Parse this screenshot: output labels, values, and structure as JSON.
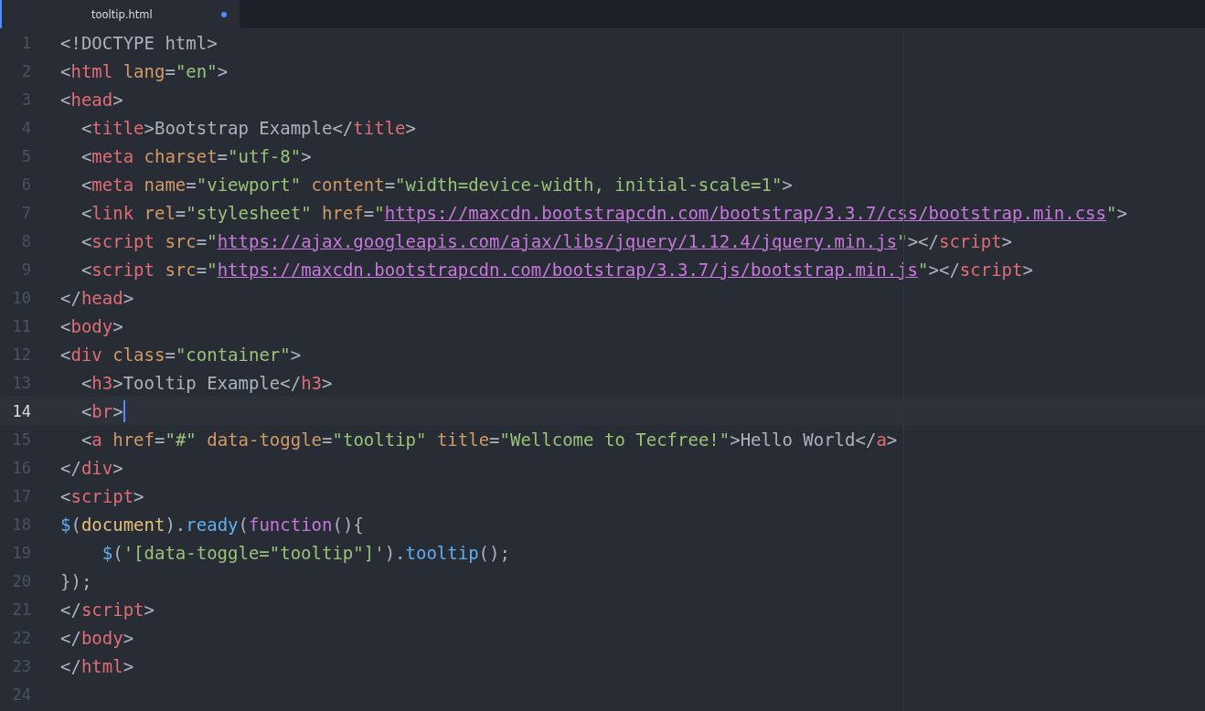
{
  "tab": {
    "label": "tooltip.html",
    "modified": true,
    "selected": true
  },
  "lines": [
    {
      "number": "1",
      "current": false,
      "tokens": [
        {
          "kind": "p",
          "text": "<!DOCTYPE html>"
        }
      ]
    },
    {
      "number": "2",
      "current": false,
      "tokens": [
        {
          "kind": "p",
          "text": "<"
        },
        {
          "kind": "g",
          "text": "html"
        },
        {
          "kind": "a",
          "text": " lang"
        },
        {
          "kind": "p",
          "text": "="
        },
        {
          "kind": "s",
          "text": "\"en\""
        },
        {
          "kind": "p",
          "text": ">"
        }
      ]
    },
    {
      "number": "3",
      "current": false,
      "tokens": [
        {
          "kind": "p",
          "text": "<"
        },
        {
          "kind": "g",
          "text": "head"
        },
        {
          "kind": "p",
          "text": ">"
        }
      ]
    },
    {
      "number": "4",
      "current": false,
      "tokens": [
        {
          "kind": "p",
          "text": "  <"
        },
        {
          "kind": "g",
          "text": "title"
        },
        {
          "kind": "p",
          "text": ">Bootstrap Example</"
        },
        {
          "kind": "g",
          "text": "title"
        },
        {
          "kind": "p",
          "text": ">"
        }
      ]
    },
    {
      "number": "5",
      "current": false,
      "tokens": [
        {
          "kind": "p",
          "text": "  <"
        },
        {
          "kind": "g",
          "text": "meta"
        },
        {
          "kind": "a",
          "text": " charset"
        },
        {
          "kind": "p",
          "text": "="
        },
        {
          "kind": "s",
          "text": "\"utf-8\""
        },
        {
          "kind": "p",
          "text": ">"
        }
      ]
    },
    {
      "number": "6",
      "current": false,
      "tokens": [
        {
          "kind": "p",
          "text": "  <"
        },
        {
          "kind": "g",
          "text": "meta"
        },
        {
          "kind": "a",
          "text": " name"
        },
        {
          "kind": "p",
          "text": "="
        },
        {
          "kind": "s",
          "text": "\"viewport\""
        },
        {
          "kind": "a",
          "text": " content"
        },
        {
          "kind": "p",
          "text": "="
        },
        {
          "kind": "s",
          "text": "\"width=device-width, initial-scale=1\""
        },
        {
          "kind": "p",
          "text": ">"
        }
      ]
    },
    {
      "number": "7",
      "current": false,
      "tokens": [
        {
          "kind": "p",
          "text": "  <"
        },
        {
          "kind": "g",
          "text": "link"
        },
        {
          "kind": "a",
          "text": " rel"
        },
        {
          "kind": "p",
          "text": "="
        },
        {
          "kind": "s",
          "text": "\"stylesheet\""
        },
        {
          "kind": "a",
          "text": " href"
        },
        {
          "kind": "p",
          "text": "="
        },
        {
          "kind": "s",
          "text": "\""
        },
        {
          "kind": "u",
          "text": "https://maxcdn.bootstrapcdn.com/bootstrap/3.3.7/css/bootstrap.min.css"
        },
        {
          "kind": "s",
          "text": "\""
        },
        {
          "kind": "p",
          "text": ">"
        }
      ]
    },
    {
      "number": "8",
      "current": false,
      "tokens": [
        {
          "kind": "p",
          "text": "  <"
        },
        {
          "kind": "g",
          "text": "script"
        },
        {
          "kind": "a",
          "text": " src"
        },
        {
          "kind": "p",
          "text": "="
        },
        {
          "kind": "s",
          "text": "\""
        },
        {
          "kind": "u",
          "text": "https://ajax.googleapis.com/ajax/libs/jquery/1.12.4/jquery.min.js"
        },
        {
          "kind": "s",
          "text": "\""
        },
        {
          "kind": "p",
          "text": "></"
        },
        {
          "kind": "g",
          "text": "script"
        },
        {
          "kind": "p",
          "text": ">"
        }
      ]
    },
    {
      "number": "9",
      "current": false,
      "tokens": [
        {
          "kind": "p",
          "text": "  <"
        },
        {
          "kind": "g",
          "text": "script"
        },
        {
          "kind": "a",
          "text": " src"
        },
        {
          "kind": "p",
          "text": "="
        },
        {
          "kind": "s",
          "text": "\""
        },
        {
          "kind": "u",
          "text": "https://maxcdn.bootstrapcdn.com/bootstrap/3.3.7/js/bootstrap.min.js"
        },
        {
          "kind": "s",
          "text": "\""
        },
        {
          "kind": "p",
          "text": "></"
        },
        {
          "kind": "g",
          "text": "script"
        },
        {
          "kind": "p",
          "text": ">"
        }
      ]
    },
    {
      "number": "10",
      "current": false,
      "tokens": [
        {
          "kind": "p",
          "text": "</"
        },
        {
          "kind": "g",
          "text": "head"
        },
        {
          "kind": "p",
          "text": ">"
        }
      ]
    },
    {
      "number": "11",
      "current": false,
      "tokens": [
        {
          "kind": "p",
          "text": "<"
        },
        {
          "kind": "g",
          "text": "body"
        },
        {
          "kind": "p",
          "text": ">"
        }
      ]
    },
    {
      "number": "12",
      "current": false,
      "tokens": [
        {
          "kind": "p",
          "text": "<"
        },
        {
          "kind": "g",
          "text": "div"
        },
        {
          "kind": "a",
          "text": " class"
        },
        {
          "kind": "p",
          "text": "="
        },
        {
          "kind": "s",
          "text": "\"container\""
        },
        {
          "kind": "p",
          "text": ">"
        }
      ]
    },
    {
      "number": "13",
      "current": false,
      "tokens": [
        {
          "kind": "p",
          "text": "  <"
        },
        {
          "kind": "g",
          "text": "h3"
        },
        {
          "kind": "p",
          "text": ">Tooltip Example</"
        },
        {
          "kind": "g",
          "text": "h3"
        },
        {
          "kind": "p",
          "text": ">"
        }
      ]
    },
    {
      "number": "14",
      "current": true,
      "tokens": [
        {
          "kind": "p",
          "text": "  <"
        },
        {
          "kind": "g",
          "text": "br"
        },
        {
          "kind": "p",
          "text": ">"
        }
      ]
    },
    {
      "number": "15",
      "current": false,
      "tokens": [
        {
          "kind": "p",
          "text": "  <"
        },
        {
          "kind": "g",
          "text": "a"
        },
        {
          "kind": "a",
          "text": " href"
        },
        {
          "kind": "p",
          "text": "="
        },
        {
          "kind": "s",
          "text": "\"#\""
        },
        {
          "kind": "a",
          "text": " data-toggle"
        },
        {
          "kind": "p",
          "text": "="
        },
        {
          "kind": "s",
          "text": "\"tooltip\""
        },
        {
          "kind": "a",
          "text": " title"
        },
        {
          "kind": "p",
          "text": "="
        },
        {
          "kind": "s",
          "text": "\"Wellcome to Tecfree!\""
        },
        {
          "kind": "p",
          "text": ">Hello World</"
        },
        {
          "kind": "g",
          "text": "a"
        },
        {
          "kind": "p",
          "text": ">"
        }
      ]
    },
    {
      "number": "16",
      "current": false,
      "tokens": [
        {
          "kind": "p",
          "text": "</"
        },
        {
          "kind": "g",
          "text": "div"
        },
        {
          "kind": "p",
          "text": ">"
        }
      ]
    },
    {
      "number": "17",
      "current": false,
      "tokens": [
        {
          "kind": "p",
          "text": "<"
        },
        {
          "kind": "g",
          "text": "script"
        },
        {
          "kind": "p",
          "text": ">"
        }
      ]
    },
    {
      "number": "18",
      "current": false,
      "tokens": [
        {
          "kind": "f",
          "text": "$"
        },
        {
          "kind": "p",
          "text": "("
        },
        {
          "kind": "v",
          "text": "document"
        },
        {
          "kind": "p",
          "text": ")."
        },
        {
          "kind": "f",
          "text": "ready"
        },
        {
          "kind": "p",
          "text": "("
        },
        {
          "kind": "k",
          "text": "function"
        },
        {
          "kind": "p",
          "text": "(){"
        }
      ]
    },
    {
      "number": "19",
      "current": false,
      "tokens": [
        {
          "kind": "f",
          "text": "    $"
        },
        {
          "kind": "p",
          "text": "("
        },
        {
          "kind": "s",
          "text": "'[data-toggle=\"tooltip\"]'"
        },
        {
          "kind": "p",
          "text": ")."
        },
        {
          "kind": "f",
          "text": "tooltip"
        },
        {
          "kind": "p",
          "text": "();"
        }
      ]
    },
    {
      "number": "20",
      "current": false,
      "tokens": [
        {
          "kind": "p",
          "text": "});"
        }
      ]
    },
    {
      "number": "21",
      "current": false,
      "tokens": [
        {
          "kind": "p",
          "text": "</"
        },
        {
          "kind": "g",
          "text": "script"
        },
        {
          "kind": "p",
          "text": ">"
        }
      ]
    },
    {
      "number": "22",
      "current": false,
      "tokens": [
        {
          "kind": "p",
          "text": "</"
        },
        {
          "kind": "g",
          "text": "body"
        },
        {
          "kind": "p",
          "text": ">"
        }
      ]
    },
    {
      "number": "23",
      "current": false,
      "tokens": [
        {
          "kind": "p",
          "text": "</"
        },
        {
          "kind": "g",
          "text": "html"
        },
        {
          "kind": "p",
          "text": ">"
        }
      ]
    },
    {
      "number": "24",
      "current": false
    }
  ]
}
